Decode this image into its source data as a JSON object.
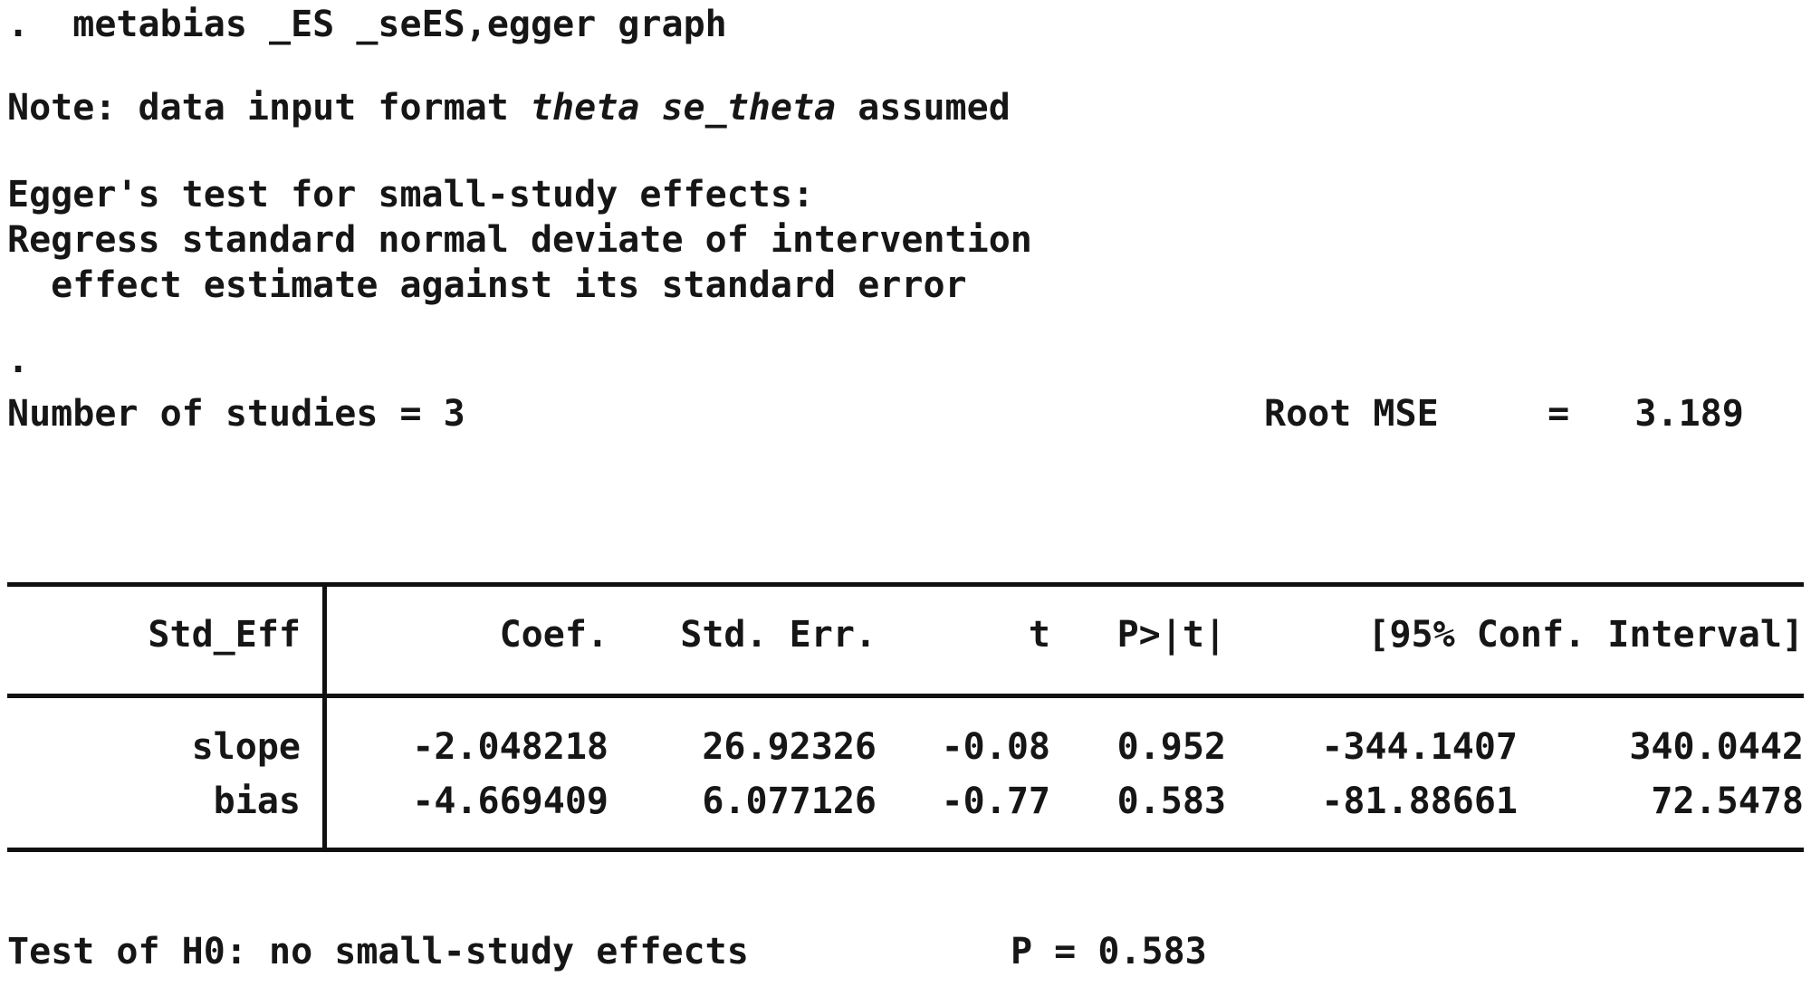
{
  "command": {
    "prompt": ".",
    "text": "metabias _ES _seES,egger graph"
  },
  "note": {
    "prefix": "Note: data input format ",
    "emphasis": "theta se_theta",
    "suffix": " assumed"
  },
  "egger": {
    "title": "Egger's test for small-study effects:",
    "description_line1": "Regress standard normal deviate of intervention",
    "description_line2": "  effect estimate against its standard error"
  },
  "prompt_dot": ".",
  "summary": {
    "studies_label": "Number of studies = ",
    "studies_value": "3",
    "rootmse_label": "Root MSE",
    "rootmse_eq": "=",
    "rootmse_value": "3.189"
  },
  "table": {
    "headers": {
      "name": "Std_Eff",
      "coef": "Coef.",
      "stderr": "Std. Err.",
      "t": "t",
      "p": "P>|t|",
      "ci": "[95% Conf. Interval]"
    },
    "rows": [
      {
        "name": "slope",
        "coef": "-2.048218",
        "stderr": "26.92326",
        "t": "-0.08",
        "p": "0.952",
        "ci_low": "-344.1407",
        "ci_high": "340.0442"
      },
      {
        "name": "bias",
        "coef": "-4.669409",
        "stderr": "6.077126",
        "t": "-0.77",
        "p": "0.583",
        "ci_low": "-81.88661",
        "ci_high": "72.5478"
      }
    ]
  },
  "test": {
    "label": "Test of H0: no small-study effects",
    "p_text": "P = 0.583"
  },
  "colors": {
    "text": "#161616",
    "rule": "#111111",
    "background": "#ffffff"
  }
}
